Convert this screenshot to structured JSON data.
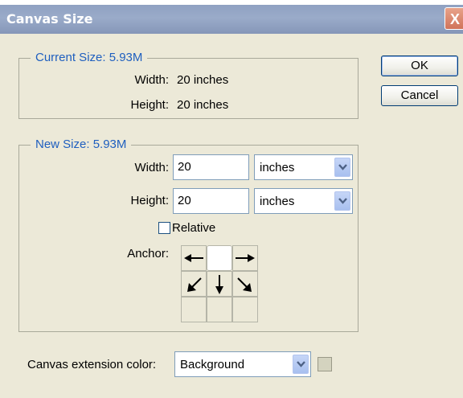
{
  "window": {
    "title": "Canvas Size",
    "close_glyph": "X"
  },
  "current_size": {
    "legend": "Current Size: 5.93M",
    "width_label": "Width:",
    "width_value": "20 inches",
    "height_label": "Height:",
    "height_value": "20 inches"
  },
  "new_size": {
    "legend": "New Size: 5.93M",
    "width_label": "Width:",
    "width_value": "20",
    "width_unit": "inches",
    "height_label": "Height:",
    "height_value": "20",
    "height_unit": "inches",
    "relative_label": "Relative",
    "relative_checked": false,
    "anchor_label": "Anchor:"
  },
  "buttons": {
    "ok": "OK",
    "cancel": "Cancel"
  },
  "extension": {
    "label": "Canvas extension color:",
    "value": "Background",
    "swatch_color": "#d4d3bf"
  },
  "colors": {
    "legend_text": "#1f5fbf",
    "titlebar": "#8fa1c2",
    "dialog_bg": "#ece9d8"
  },
  "icons": {
    "anchor_arrows": [
      "",
      "arrow-left-icon",
      "",
      "arrow-right-icon",
      "arrow-down-left-icon",
      "arrow-down-icon",
      "arrow-down-right-icon",
      "",
      ""
    ],
    "dropdown": "chevron-down-icon"
  }
}
